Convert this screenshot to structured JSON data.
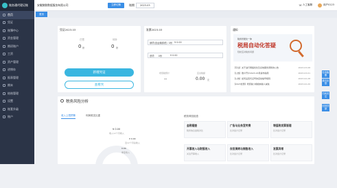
{
  "app": {
    "logo_text": "账务通代理记账"
  },
  "sidebar": {
    "items": [
      {
        "label": "首页",
        "icon": "home-icon",
        "active": true
      },
      {
        "label": "凭证",
        "icon": "voucher-icon"
      },
      {
        "label": "账簿中心",
        "icon": "ledger-icon"
      },
      {
        "label": "资金管理",
        "icon": "fund-icon"
      },
      {
        "label": "期初账户",
        "icon": "account-icon"
      },
      {
        "label": "工资",
        "icon": "salary-icon"
      },
      {
        "label": "资产管理",
        "icon": "asset-icon"
      },
      {
        "label": "进销存",
        "icon": "inventory-icon"
      },
      {
        "label": "报表管理",
        "icon": "report-icon"
      },
      {
        "label": "期末",
        "icon": "period-end-icon"
      },
      {
        "label": "结账管理",
        "icon": "close-books-icon"
      },
      {
        "label": "设置",
        "icon": "settings-icon"
      },
      {
        "label": "账套升级",
        "icon": "upgrade-icon"
      },
      {
        "label": "账户",
        "icon": "user-icon"
      }
    ]
  },
  "topbar": {
    "company": "安徽鲸鲸数据服务有限公司",
    "switch_button": "立即切换",
    "period_label": "账期",
    "period_value": "2023-03",
    "service": "人工客服",
    "username": "用户0123"
  },
  "tabs": [
    {
      "label": "首页"
    }
  ],
  "voucher_card": {
    "title": "凭证2023.03",
    "col1_label": "已签",
    "col1_value": "0",
    "col1_unit": "张",
    "col2_label": "待补",
    "col2_value": "0",
    "col2_unit": "张",
    "primary_button": "新增凭证",
    "secondary_button": "查看凭"
  },
  "tax_card": {
    "title": "发票2023.03",
    "row1_label": "销项(含运输费税)",
    "row1_value": "0份",
    "row1_amount": "¥ 0.00",
    "row2_label": "进项",
    "row2_value": "0份",
    "row2_amount": "¥ 0.00",
    "stat1_label": "增值税预计",
    "stat1_value": "--",
    "stat2_label": "应交税额",
    "stat2_value": "0.00",
    "stat2_unit": "元"
  },
  "notice_card": {
    "title": "通知",
    "banner_tag": "税务智能化一体",
    "banner_title": "税局自动化答疑",
    "banner_sub": "轻松应对税务问题",
    "items": [
      {
        "text": "【平台】关于进行网络优化及系统服务调整的公告",
        "date": "2023-03-08"
      },
      {
        "text": "【公告】账户开户2023-03月操作指南",
        "date": "2023-03-01"
      },
      {
        "text": "【公告】如何设置凭证号的自动编号规则",
        "date": "2023-02-28"
      },
      {
        "text": "【2023优惠】增值税小规模纳税人减免",
        "date": "2023-02-20"
      }
    ]
  },
  "risk": {
    "section_title": "税务风险分析",
    "tab1": "收入上限预警",
    "tab2": "利润收支比重",
    "amount": "¥ 0.00",
    "amount_sub": "收入12个月收入",
    "legend1": "¥ 0.00",
    "legend1_sub": "近12个月总收入",
    "legend2": "0.00",
    "legend2_sub": "季度收入",
    "right_title": "税务风险检查",
    "tiles": [
      {
        "title": "金税稽查",
        "sub": "税务信息金税对比"
      },
      {
        "title": "广告与业务宣传费",
        "sub": "比对会计记录"
      },
      {
        "title": "增值税发票管理",
        "sub": "比对会计记录"
      },
      {
        "title": "开票收入与财报收入",
        "sub": "关注开票收入"
      },
      {
        "title": "存货周转与销售收入",
        "sub": "比对会计记录"
      },
      {
        "title": "发票异常",
        "sub": "比对会计记录"
      }
    ]
  },
  "float_buttons": [
    "在线客服",
    "建议反馈",
    "扫码关注",
    "回到顶部"
  ]
}
